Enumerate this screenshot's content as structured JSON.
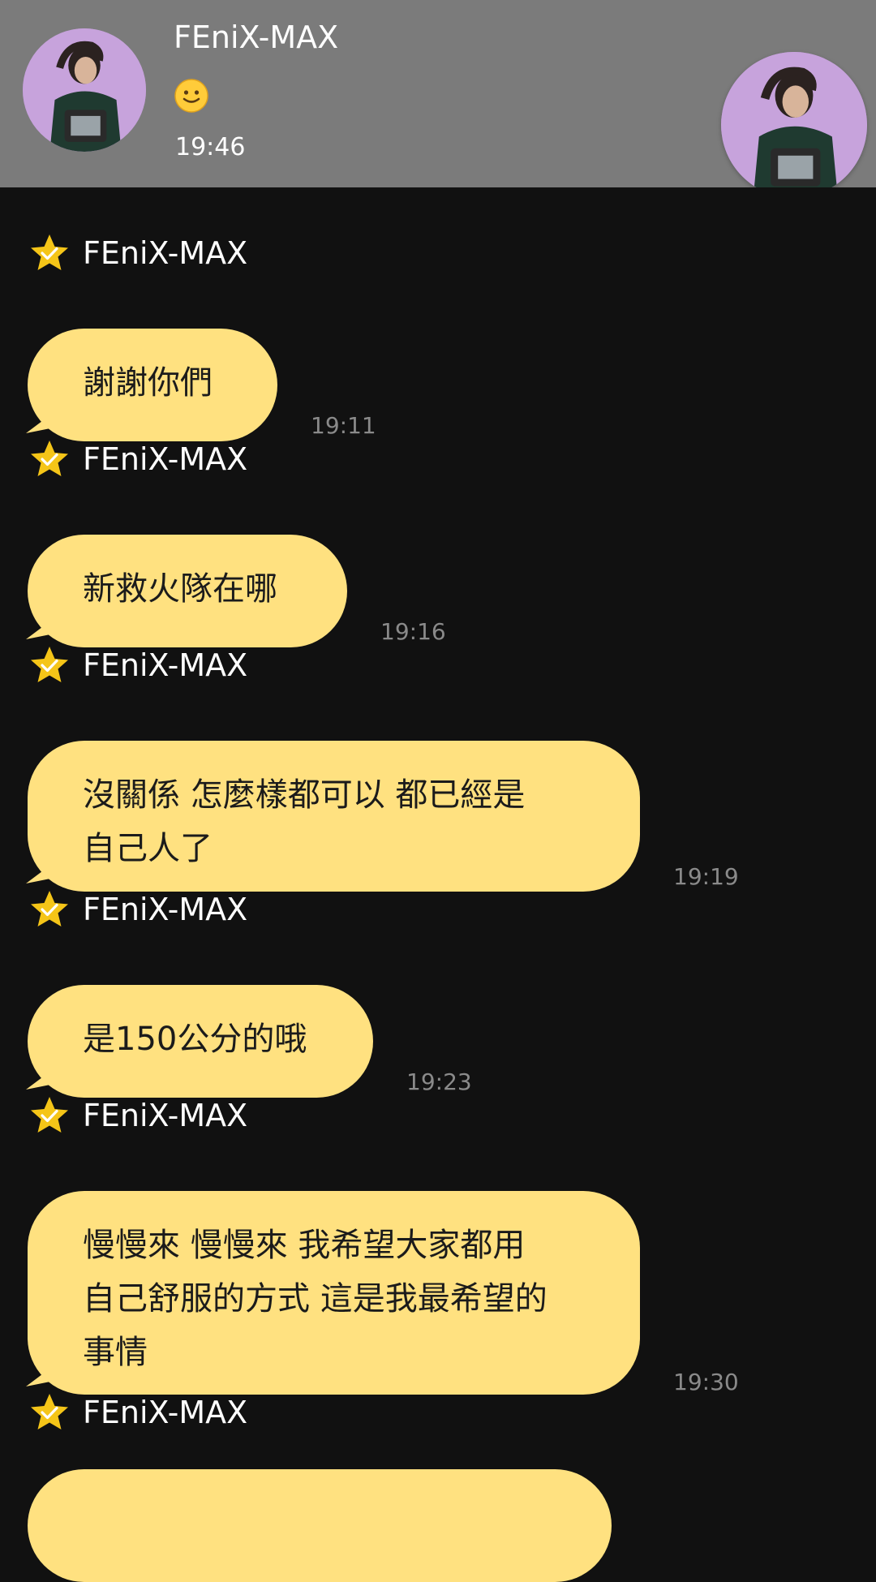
{
  "header": {
    "name": "FEniX-MAX",
    "status_emoji": "🙂",
    "time": "19:46"
  },
  "colors": {
    "header_bg": "#7b7b7b",
    "chat_bg": "#111111",
    "bubble": "#ffe180",
    "star": "#f5c518",
    "timestamp": "#8a8a8a"
  },
  "messages": [
    {
      "sender": "FEniX-MAX",
      "text": "謝謝你們",
      "time": "19:11"
    },
    {
      "sender": "FEniX-MAX",
      "text": "新救火隊在哪",
      "time": "19:16"
    },
    {
      "sender": "FEniX-MAX",
      "text": "沒關係 怎麼樣都可以 都已經是\n自己人了",
      "time": "19:19"
    },
    {
      "sender": "FEniX-MAX",
      "text": "是150公分的哦",
      "time": "19:23"
    },
    {
      "sender": "FEniX-MAX",
      "text": "慢慢來 慢慢來 我希望大家都用\n自己舒服的方式 這是我最希望的\n事情",
      "time": "19:30"
    },
    {
      "sender": "FEniX-MAX",
      "text": "",
      "time": ""
    }
  ]
}
